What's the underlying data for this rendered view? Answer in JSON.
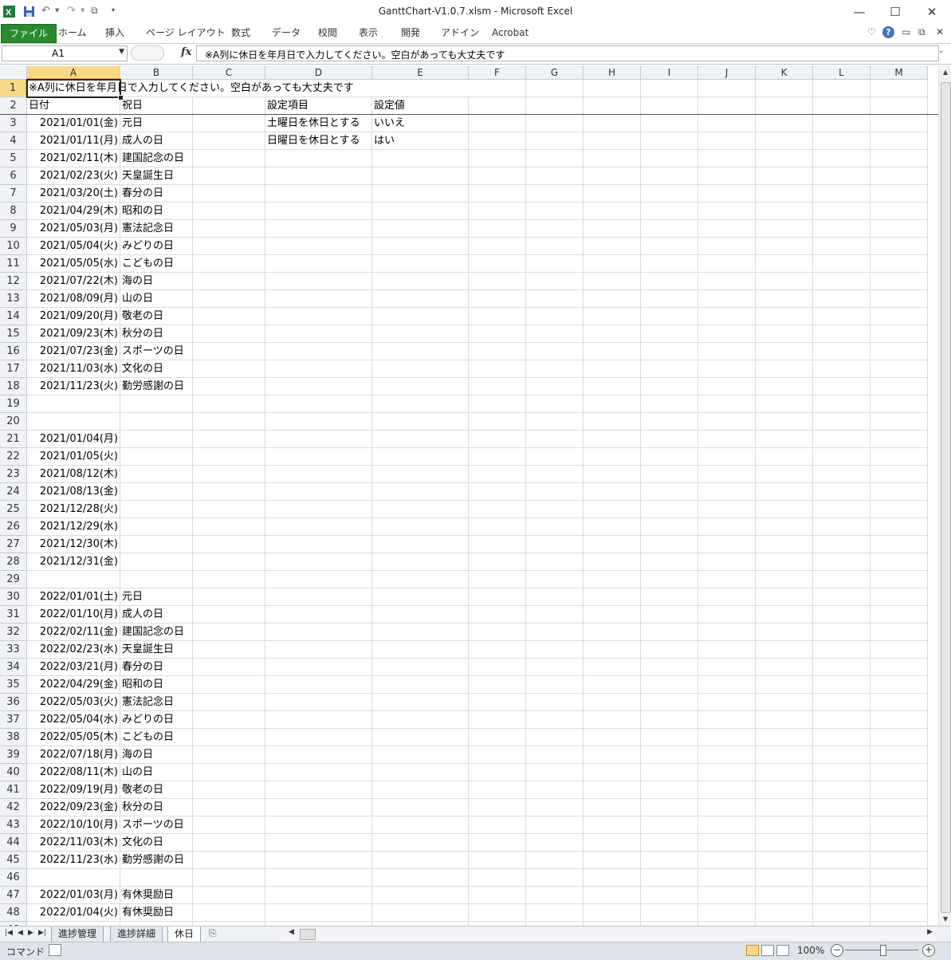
{
  "app": {
    "window_title": "GanttChart-V1.0.7.xlsm  -  Microsoft Excel",
    "window_buttons": [
      "minimize-icon",
      "maximize-icon",
      "close-icon"
    ]
  },
  "ribbon": {
    "tabs": [
      "ファイル",
      "ホーム",
      "挿入",
      "ページ レイアウト",
      "数式",
      "データ",
      "校閲",
      "表示",
      "開発",
      "アドイン",
      "Acrobat"
    ]
  },
  "formula_bar": {
    "name_box": "A1",
    "fx_label": "fx",
    "content": "※A列に休日を年月日で入力してください。空白があっても大丈夫です"
  },
  "columns": [
    "A",
    "B",
    "C",
    "D",
    "E",
    "F",
    "G",
    "H",
    "I",
    "J",
    "K",
    "L",
    "M"
  ],
  "rows": [
    {
      "n": "1",
      "A": "※A列に休日を年月日で入力してください。空白があっても大丈夫です",
      "B": "",
      "D": "",
      "E": ""
    },
    {
      "n": "2",
      "A": "日付",
      "B": "祝日",
      "D": "設定項目",
      "E": "設定値"
    },
    {
      "n": "3",
      "A": "2021/01/01(金)",
      "B": "元日",
      "D": "土曜日を休日とする",
      "E": "いいえ"
    },
    {
      "n": "4",
      "A": "2021/01/11(月)",
      "B": "成人の日",
      "D": "日曜日を休日とする",
      "E": "はい"
    },
    {
      "n": "5",
      "A": "2021/02/11(木)",
      "B": "建国記念の日"
    },
    {
      "n": "6",
      "A": "2021/02/23(火)",
      "B": "天皇誕生日"
    },
    {
      "n": "7",
      "A": "2021/03/20(土)",
      "B": "春分の日"
    },
    {
      "n": "8",
      "A": "2021/04/29(木)",
      "B": "昭和の日"
    },
    {
      "n": "9",
      "A": "2021/05/03(月)",
      "B": "憲法記念日"
    },
    {
      "n": "10",
      "A": "2021/05/04(火)",
      "B": "みどりの日"
    },
    {
      "n": "11",
      "A": "2021/05/05(水)",
      "B": "こどもの日"
    },
    {
      "n": "12",
      "A": "2021/07/22(木)",
      "B": "海の日"
    },
    {
      "n": "13",
      "A": "2021/08/09(月)",
      "B": "山の日"
    },
    {
      "n": "14",
      "A": "2021/09/20(月)",
      "B": "敬老の日"
    },
    {
      "n": "15",
      "A": "2021/09/23(木)",
      "B": "秋分の日"
    },
    {
      "n": "16",
      "A": "2021/07/23(金)",
      "B": "スポーツの日"
    },
    {
      "n": "17",
      "A": "2021/11/03(水)",
      "B": "文化の日"
    },
    {
      "n": "18",
      "A": "2021/11/23(火)",
      "B": "勤労感謝の日"
    },
    {
      "n": "19",
      "A": "",
      "B": ""
    },
    {
      "n": "20",
      "A": "",
      "B": ""
    },
    {
      "n": "21",
      "A": "2021/01/04(月)",
      "B": ""
    },
    {
      "n": "22",
      "A": "2021/01/05(火)",
      "B": ""
    },
    {
      "n": "23",
      "A": "2021/08/12(木)",
      "B": ""
    },
    {
      "n": "24",
      "A": "2021/08/13(金)",
      "B": ""
    },
    {
      "n": "25",
      "A": "2021/12/28(火)",
      "B": ""
    },
    {
      "n": "26",
      "A": "2021/12/29(水)",
      "B": ""
    },
    {
      "n": "27",
      "A": "2021/12/30(木)",
      "B": ""
    },
    {
      "n": "28",
      "A": "2021/12/31(金)",
      "B": ""
    },
    {
      "n": "29",
      "A": "",
      "B": ""
    },
    {
      "n": "30",
      "A": "2022/01/01(土)",
      "B": "元日"
    },
    {
      "n": "31",
      "A": "2022/01/10(月)",
      "B": "成人の日"
    },
    {
      "n": "32",
      "A": "2022/02/11(金)",
      "B": "建国記念の日"
    },
    {
      "n": "33",
      "A": "2022/02/23(水)",
      "B": "天皇誕生日"
    },
    {
      "n": "34",
      "A": "2022/03/21(月)",
      "B": "春分の日"
    },
    {
      "n": "35",
      "A": "2022/04/29(金)",
      "B": "昭和の日"
    },
    {
      "n": "36",
      "A": "2022/05/03(火)",
      "B": "憲法記念日"
    },
    {
      "n": "37",
      "A": "2022/05/04(水)",
      "B": "みどりの日"
    },
    {
      "n": "38",
      "A": "2022/05/05(木)",
      "B": "こどもの日"
    },
    {
      "n": "39",
      "A": "2022/07/18(月)",
      "B": "海の日"
    },
    {
      "n": "40",
      "A": "2022/08/11(木)",
      "B": "山の日"
    },
    {
      "n": "41",
      "A": "2022/09/19(月)",
      "B": "敬老の日"
    },
    {
      "n": "42",
      "A": "2022/09/23(金)",
      "B": "秋分の日"
    },
    {
      "n": "43",
      "A": "2022/10/10(月)",
      "B": "スポーツの日"
    },
    {
      "n": "44",
      "A": "2022/11/03(木)",
      "B": "文化の日"
    },
    {
      "n": "45",
      "A": "2022/11/23(水)",
      "B": "勤労感謝の日"
    },
    {
      "n": "46",
      "A": "",
      "B": ""
    },
    {
      "n": "47",
      "A": "2022/01/03(月)",
      "B": "有休奨励日"
    },
    {
      "n": "48",
      "A": "2022/01/04(火)",
      "B": "有休奨励日"
    },
    {
      "n": "49",
      "A": "",
      "B": ""
    }
  ],
  "sheet_tabs": [
    "進捗管理",
    "進捗詳細",
    "休日"
  ],
  "active_sheet": "休日",
  "status_bar": {
    "mode": "コマンド",
    "zoom": "100%"
  },
  "colors": {
    "file_tab": "#2a8a2f",
    "selected_header": "#f8d98a",
    "gridline": "#dadcdd"
  }
}
